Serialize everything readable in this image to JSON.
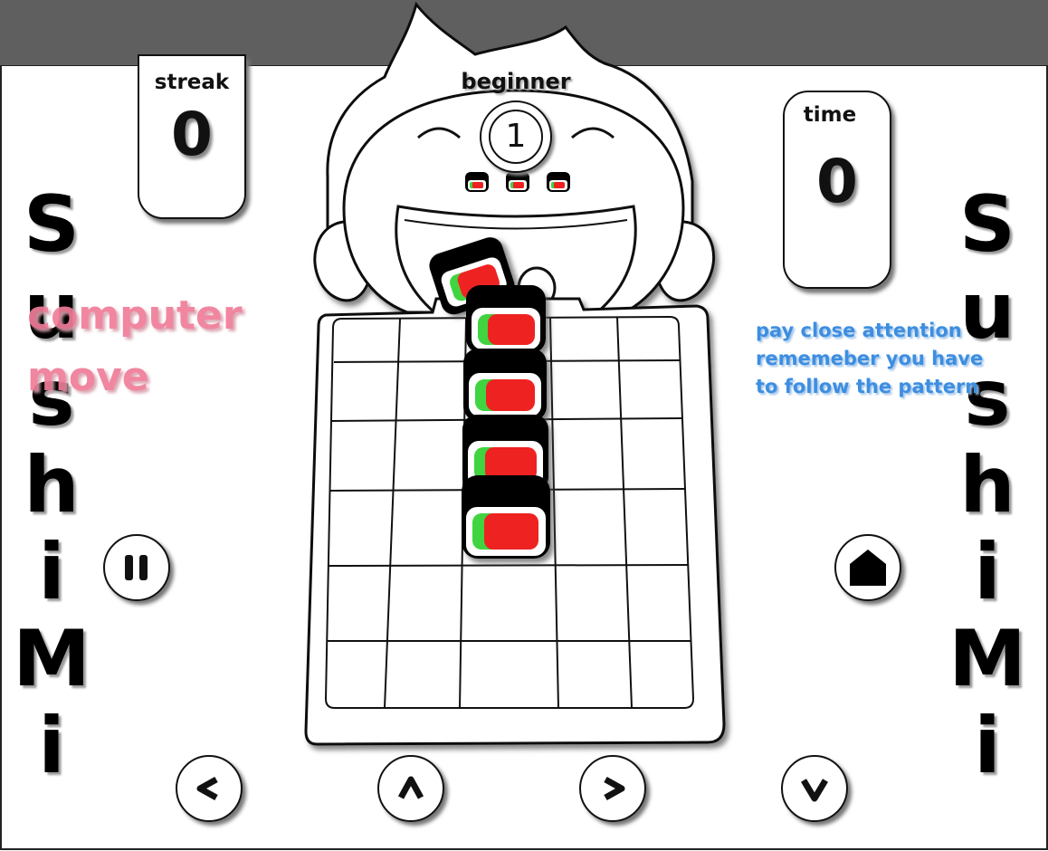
{
  "game": {
    "side_title_letters": [
      "S",
      "u",
      "s",
      "h",
      "i",
      "M",
      "i"
    ],
    "streak": {
      "label": "streak",
      "value": "0"
    },
    "time": {
      "label": "time",
      "value": "0"
    },
    "level": {
      "name": "beginner",
      "number": "1"
    },
    "status_message": "computer move",
    "instructions": "pay close attention rememeber you have to follow the pattern",
    "buttons": {
      "pause": "pause",
      "home": "home",
      "left": "<",
      "up": "^",
      "right": ">",
      "down": "v"
    },
    "colors": {
      "status_pink": "#f07c99",
      "hint_blue": "#3d8ee0",
      "sushi_red": "#ef2020",
      "sushi_green": "#3fd43f",
      "seaweed": "#000000"
    },
    "board": {
      "columns": 5,
      "rows": 6,
      "sushi_in_column": 3,
      "sushi_count": 4
    },
    "lives_remaining": 3
  }
}
